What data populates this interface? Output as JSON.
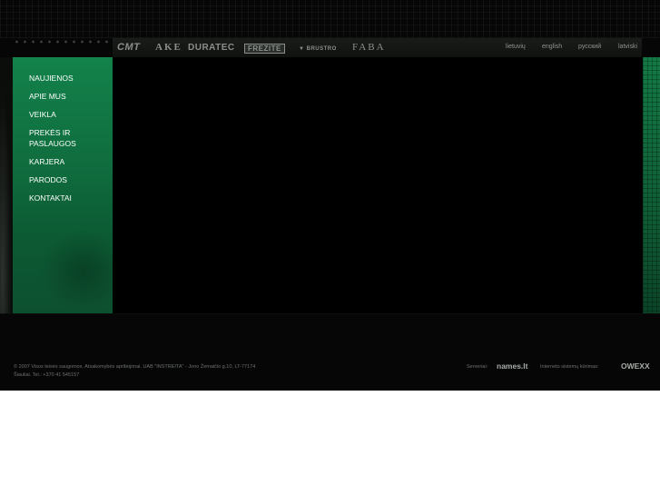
{
  "brands": [
    "CMT",
    "AKE",
    "DURATEC",
    "FREZITE",
    "BRUSTRO",
    "FABA"
  ],
  "languages": [
    "lietuvių",
    "english",
    "русский",
    "latviski"
  ],
  "menu": {
    "items": [
      "NAUJIENOS",
      "APIE MUS",
      "VEIKLA",
      "PREKĖS IR PASLAUGOS",
      "KARJERA",
      "PARODOS",
      "KONTAKTAI"
    ]
  },
  "footer": {
    "copyright_line1": "© 2007 Visos teisės saugomos. Atsakomybės apribojimai. UAB \"INSTREITA\" - Jono Žemaičio g.10, LT-77174",
    "copyright_line2": "Šiauliai. Tel.: +370 41 545157",
    "server_label": "Serveriai:",
    "server_logo": "names.lt",
    "developer_label": "Interneto sistemų kūrimas:",
    "developer_logo": "OWEXX"
  },
  "colors": {
    "sidebar_green": "#13824b",
    "background": "#050605",
    "text_muted": "#6e736f"
  }
}
